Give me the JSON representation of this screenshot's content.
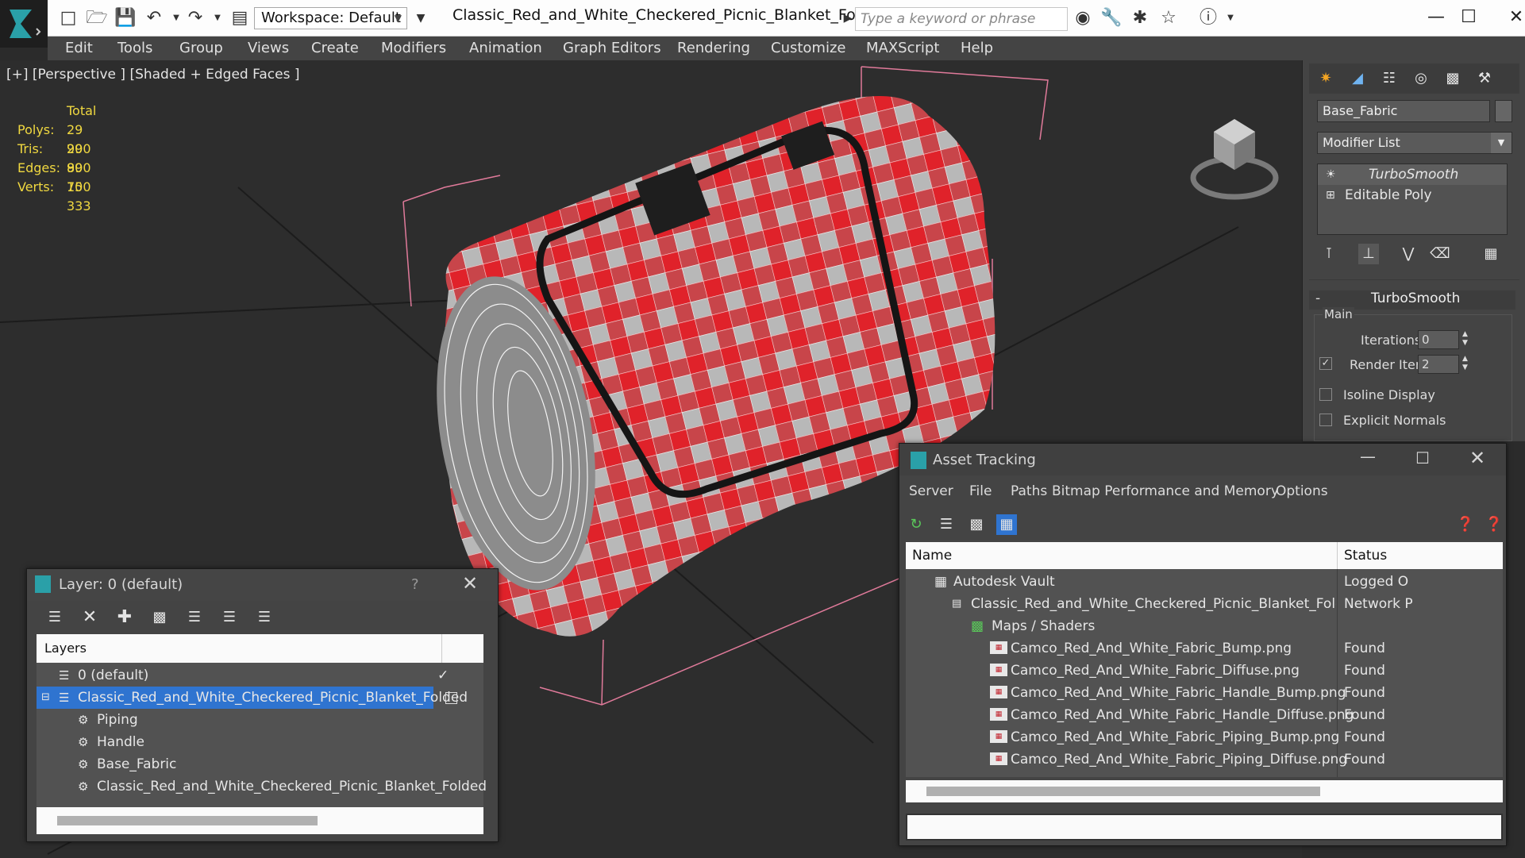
{
  "window": {
    "title": "Classic_Red_and_White_Checkered_Picnic_Blanket_Folded_...",
    "workspace": "Workspace: Default",
    "search_placeholder": "Type a keyword or phrase"
  },
  "menu": [
    "Edit",
    "Tools",
    "Group",
    "Views",
    "Create",
    "Modifiers",
    "Animation",
    "Graph Editors",
    "Rendering",
    "Customize",
    "MAXScript",
    "Help"
  ],
  "viewport": {
    "label": "[+] [Perspective ] [Shaded + Edged Faces ]",
    "stats": {
      "header": "Total",
      "rows": [
        {
          "label": "Polys:",
          "value": "29 900"
        },
        {
          "label": "Tris:",
          "value": "29 900"
        },
        {
          "label": "Edges:",
          "value": "89 700"
        },
        {
          "label": "Verts:",
          "value": "15 333"
        }
      ]
    }
  },
  "command_panel": {
    "object_name": "Base_Fabric",
    "modifier_list": "Modifier List",
    "stack": [
      "TurboSmooth",
      "Editable Poly"
    ],
    "rollout_title": "TurboSmooth",
    "group_main": "Main",
    "iterations_label": "Iterations:",
    "iterations_value": "0",
    "render_iters_label": "Render Iters:",
    "render_iters_value": "2",
    "isoline_label": "Isoline Display",
    "explicit_normals_label": "Explicit Normals",
    "collapse_glyph": "-"
  },
  "layer_dialog": {
    "title": "Layer: 0 (default)",
    "help": "?",
    "column": "Layers",
    "rows": [
      {
        "label": "0 (default)"
      },
      {
        "label": "Classic_Red_and_White_Checkered_Picnic_Blanket_Folded"
      },
      {
        "label": "Piping"
      },
      {
        "label": "Handle"
      },
      {
        "label": "Base_Fabric"
      },
      {
        "label": "Classic_Red_and_White_Checkered_Picnic_Blanket_Folded"
      }
    ]
  },
  "asset_tracking": {
    "title": "Asset Tracking",
    "menu": [
      "Server",
      "File",
      "Paths",
      "Bitmap Performance and Memory",
      "Options"
    ],
    "columns": [
      "Name",
      "Status"
    ],
    "rows": [
      {
        "name": "Autodesk Vault",
        "status": "Logged O"
      },
      {
        "name": "Classic_Red_and_White_Checkered_Picnic_Blanket_Folded_max_vray.max",
        "status": "Network P"
      },
      {
        "name": "Maps / Shaders",
        "status": ""
      },
      {
        "name": "Camco_Red_And_White_Fabric_Bump.png",
        "status": "Found"
      },
      {
        "name": "Camco_Red_And_White_Fabric_Diffuse.png",
        "status": "Found"
      },
      {
        "name": "Camco_Red_And_White_Fabric_Handle_Bump.png",
        "status": "Found"
      },
      {
        "name": "Camco_Red_And_White_Fabric_Handle_Diffuse.png",
        "status": "Found"
      },
      {
        "name": "Camco_Red_And_White_Fabric_Piping_Bump.png",
        "status": "Found"
      },
      {
        "name": "Camco_Red_And_White_Fabric_Piping_Diffuse.png",
        "status": "Found"
      }
    ]
  },
  "colors": {
    "accent": "#2f74d0",
    "stats_yellow": "#f0d840",
    "blanket_red": "#e0222a"
  }
}
